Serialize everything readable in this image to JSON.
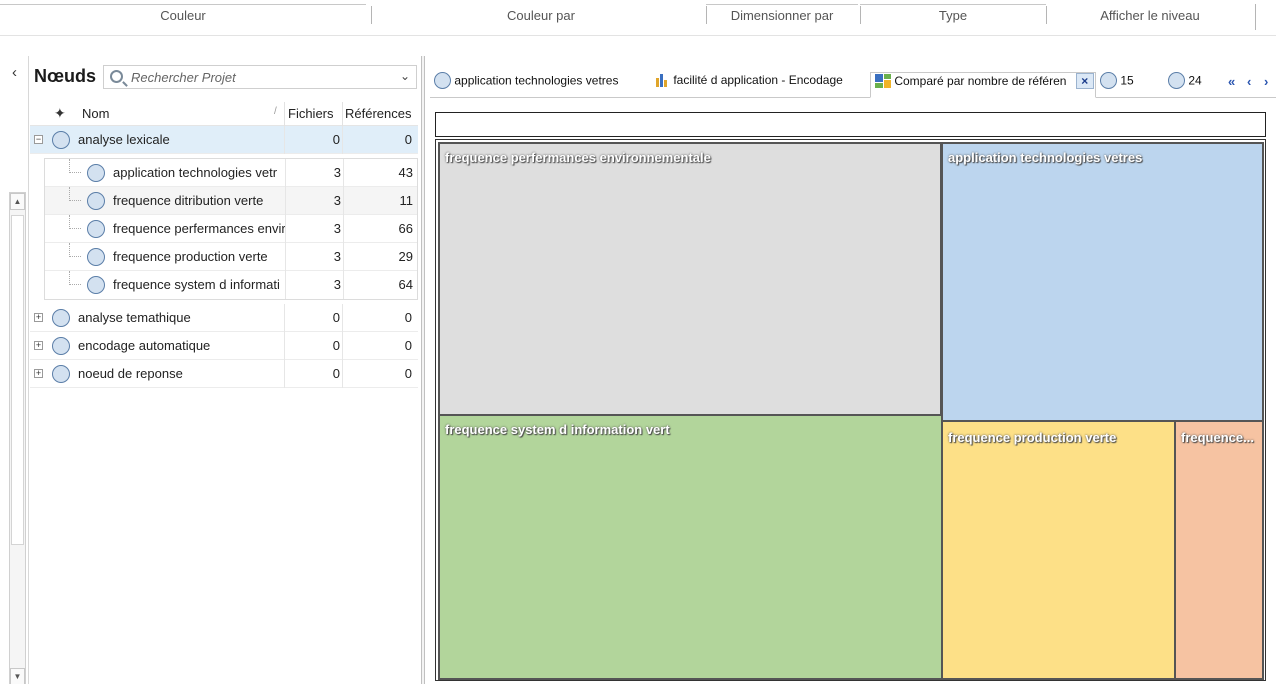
{
  "ribbon": {
    "groups": [
      "Couleur",
      "Couleur par",
      "Dimensionner par",
      "Type",
      "Afficher le niveau"
    ]
  },
  "nodes_panel": {
    "title": "Nœuds",
    "search_placeholder": "Rechercher Projet",
    "columns": {
      "name": "Nom",
      "files": "Fichiers",
      "refs": "Références"
    },
    "rows": [
      {
        "label": "analyse lexicale",
        "files": "0",
        "refs": "0",
        "expanded": true,
        "level": 0
      },
      {
        "label": "application technologies vetr",
        "files": "3",
        "refs": "43",
        "level": 1
      },
      {
        "label": "frequence ditribution verte",
        "files": "3",
        "refs": "11",
        "level": 1
      },
      {
        "label": "frequence perfermances envir",
        "files": "3",
        "refs": "66",
        "level": 1
      },
      {
        "label": "frequence production verte",
        "files": "3",
        "refs": "29",
        "level": 1
      },
      {
        "label": "frequence system d informati",
        "files": "3",
        "refs": "64",
        "level": 1
      },
      {
        "label": "analyse temathique",
        "files": "0",
        "refs": "0",
        "expanded": false,
        "level": 0
      },
      {
        "label": "encodage automatique",
        "files": "0",
        "refs": "0",
        "expanded": false,
        "level": 0
      },
      {
        "label": "noeud de reponse",
        "files": "0",
        "refs": "0",
        "expanded": false,
        "level": 0
      }
    ]
  },
  "tabs": [
    {
      "label": "application technologies vetres",
      "icon": "node-circle-icon"
    },
    {
      "label": "facilité d application - Encodage",
      "icon": "bar-chart-icon"
    },
    {
      "label": "Comparé par nombre de référen",
      "icon": "treemap-icon",
      "active": true
    },
    {
      "label": "15",
      "icon": "node-circle-icon"
    },
    {
      "label": "24",
      "icon": "node-circle-icon"
    }
  ],
  "tab_nav": {
    "first": "«",
    "prev": "‹",
    "next": "›"
  },
  "colors": {
    "gray": "#dedede",
    "blue": "#bcd5ee",
    "green": "#b2d59b",
    "yellow": "#fde087",
    "orange": "#f6c3a2"
  },
  "treemap": {
    "cells": [
      {
        "label": "frequence perfermances environnementale",
        "value": 66,
        "color": "gray"
      },
      {
        "label": "application technologies vetres",
        "value": 43,
        "color": "blue"
      },
      {
        "label": "frequence system d information vert",
        "value": 64,
        "color": "green"
      },
      {
        "label": "frequence production verte",
        "value": 29,
        "color": "yellow"
      },
      {
        "label": "frequence...",
        "value": 11,
        "color": "orange"
      }
    ]
  }
}
